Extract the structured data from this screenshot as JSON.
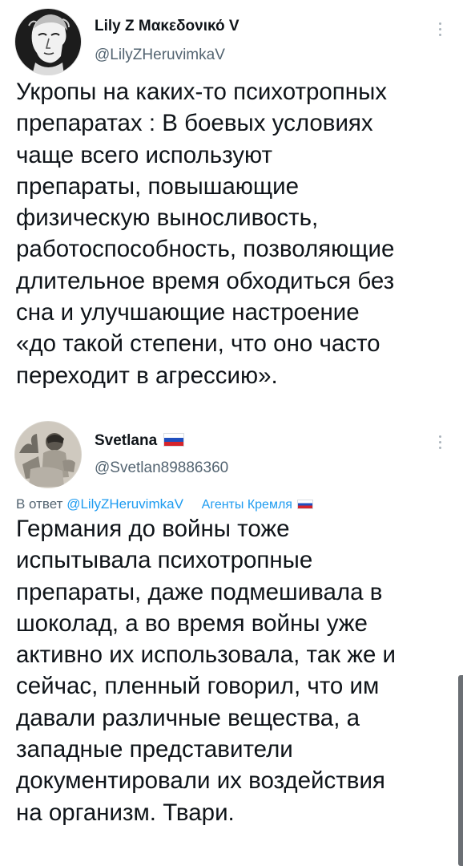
{
  "tweets": [
    {
      "author_name": "Lily Z Μακεδονικό V",
      "handle": "@LilyZHeruvimkaV",
      "lines": [
        "Укропы на каких-то психотропных",
        "препаратах : В боевых условиях",
        "чаще всего используют",
        "препараты, повышающие",
        "физическую выносливость,",
        "работоспособность, позволяющие",
        "длительное время обходиться без",
        "сна и улучшающие настроение",
        "«до такой степени, что оно часто",
        "переходит в агрессию»."
      ],
      "avatar_icon": "classical-bust-portrait"
    },
    {
      "author_name": "Svetlana",
      "handle": "@Svetlan89886360",
      "reply_prefix": "В ответ",
      "reply_to": "@LilyZHeruvimkaV",
      "tag_label": "Агенты Кремля",
      "lines": [
        "Германия до войны тоже",
        "испытывала психотропные",
        "препараты, даже подмешивала в",
        "шоколад, а во время войны уже",
        "активно их использовала, так же и",
        "сейчас, пленный говорил, что им",
        "давали различные вещества, а",
        "западные представители",
        "документировали их воздействия",
        "на организм. Твари."
      ],
      "avatar_icon": "vintage-photo-portrait",
      "name_badge": "russian-flag-icon"
    }
  ],
  "colors": {
    "text": "#0f1419",
    "secondary": "#536471",
    "link": "#1d9bf0"
  }
}
